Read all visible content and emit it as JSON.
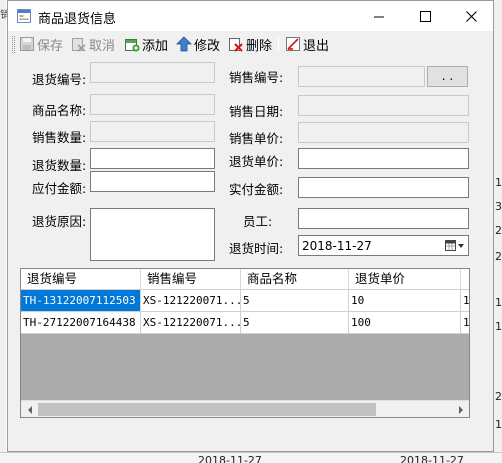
{
  "window": {
    "title": "商品退货信息"
  },
  "toolbar": {
    "save": "保存",
    "cancel": "取消",
    "add": "添加",
    "edit": "修改",
    "delete": "删除",
    "exit": "退出"
  },
  "form": {
    "return_no_label": "退货编号:",
    "product_name_label": "商品名称:",
    "sale_qty_label": "销售数量:",
    "return_qty_label": "退货数量:",
    "payable_label": "应付金额:",
    "return_reason_label": "退货原因:",
    "sale_no_label": "销售编号:",
    "sale_date_label": "销售日期:",
    "sale_price_label": "销售单价:",
    "return_price_label": "退货单价:",
    "paid_label": "实付金额:",
    "employee_label": "员工:",
    "return_time_label": "退货时间:",
    "return_time_value": "2018-11-27",
    "browse_label": ". ."
  },
  "grid": {
    "columns": [
      "退货编号",
      "销售编号",
      "商品名称",
      "退货单价"
    ],
    "rows": [
      {
        "return_no": "TH-13122007112503",
        "sale_no": "XS-121220071...",
        "product": "5",
        "price": "10",
        "extra": "1"
      },
      {
        "return_no": "TH-27122007164438",
        "sale_no": "XS-121220071...",
        "product": "5",
        "price": "100",
        "extra": "1"
      }
    ]
  },
  "background": {
    "left_char": "销",
    "bottom_left": "2018-11-27",
    "bottom_right": "2018-11-27",
    "right_digits": [
      "1",
      "3",
      "2",
      "2",
      "1",
      "1",
      "2",
      "1"
    ]
  },
  "colors": {
    "selection": "#0078d7",
    "window_bg": "#f0f0f0",
    "grid_bg": "#ababab"
  },
  "icons": [
    "app-form-icon",
    "minimize-icon",
    "maximize-icon",
    "close-icon",
    "save-disk-icon",
    "cancel-icon",
    "add-icon",
    "edit-up-arrow-icon",
    "delete-icon",
    "exit-icon",
    "calendar-icon",
    "dropdown-arrow-icon",
    "scroll-left-icon",
    "scroll-right-icon"
  ]
}
